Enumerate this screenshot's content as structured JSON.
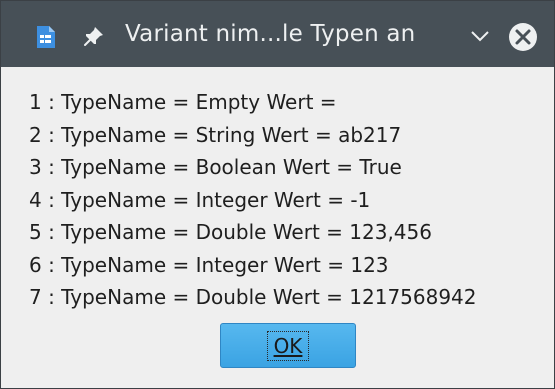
{
  "window": {
    "title": "Variant nim...le Typen an",
    "icons": {
      "app": "document-app-icon",
      "pin": "pin-icon",
      "menu": "chevron-down-icon",
      "close": "close-icon"
    },
    "colors": {
      "titlebar": "#475057",
      "titlebar_text": "#eef0f1",
      "body": "#efefef",
      "button": "#3aa3e3",
      "app_icon": "#3d8fe0"
    }
  },
  "message": {
    "lines": [
      "1 : TypeName = Empty Wert =",
      "2 : TypeName = String Wert = ab217",
      "3 : TypeName = Boolean Wert = True",
      "4 : TypeName = Integer Wert = -1",
      "5 : TypeName = Double Wert = 123,456",
      "6 : TypeName = Integer Wert = 123",
      "7 : TypeName = Double Wert = 1217568942"
    ]
  },
  "buttons": {
    "ok_label": "OK"
  }
}
